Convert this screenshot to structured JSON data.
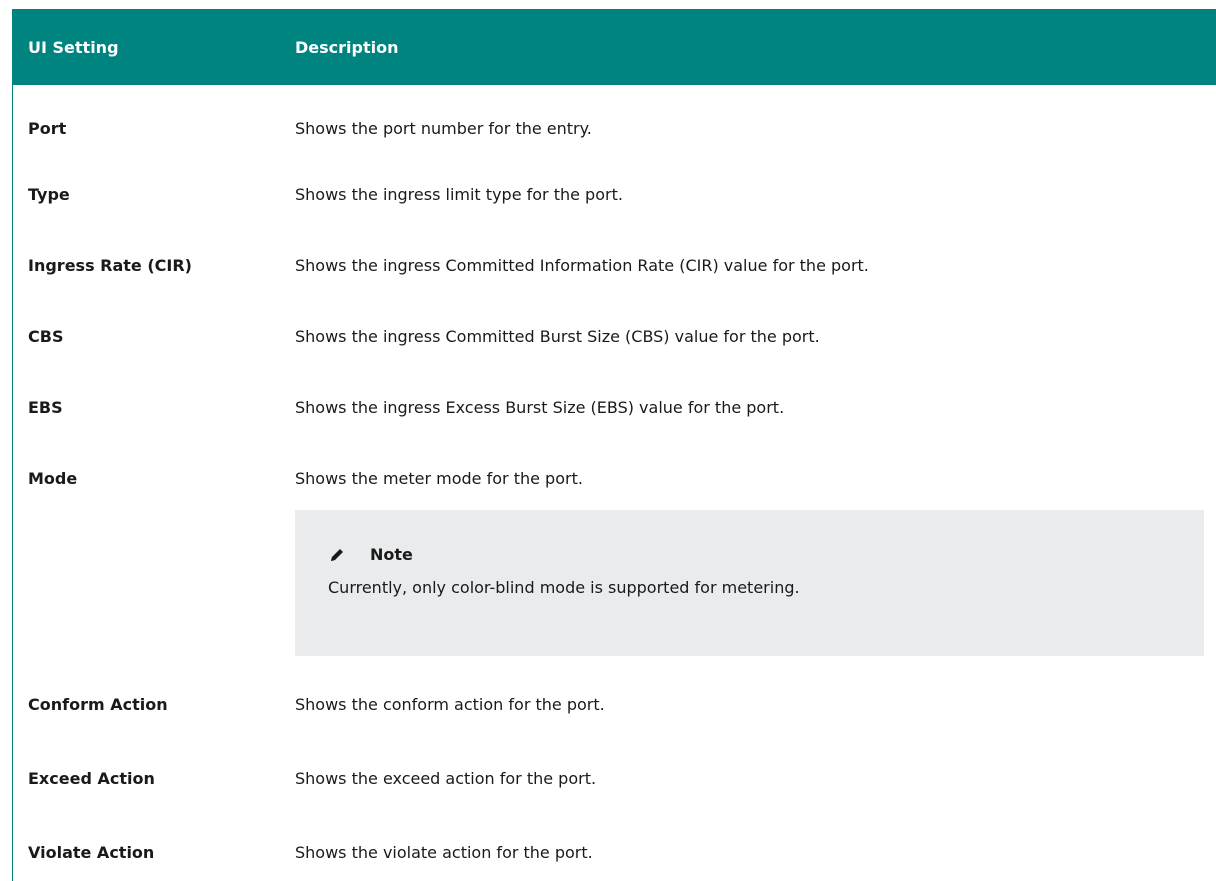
{
  "header": {
    "col_setting": "UI Setting",
    "col_description": "Description"
  },
  "rows": [
    {
      "setting": "Port",
      "description": "Shows the port number for the entry."
    },
    {
      "setting": "Type",
      "description": "Shows the ingress limit type for the port."
    },
    {
      "setting": "Ingress Rate (CIR)",
      "description": "Shows the ingress Committed Information Rate (CIR) value for the port."
    },
    {
      "setting": "CBS",
      "description": "Shows the ingress Committed Burst Size (CBS) value for the port."
    },
    {
      "setting": "EBS",
      "description": "Shows the ingress Excess Burst Size (EBS) value for the port."
    },
    {
      "setting": "Mode",
      "description": "Shows the meter mode for the port."
    },
    {
      "setting": "Conform Action",
      "description": "Shows the conform action for the port."
    },
    {
      "setting": "Exceed Action",
      "description": "Shows the exceed action for the port."
    },
    {
      "setting": "Violate Action",
      "description": "Shows the violate action for the port."
    }
  ],
  "note": {
    "icon": "pencil-icon",
    "title": "Note",
    "text": "Currently, only color-blind mode is supported for metering."
  },
  "colors": {
    "header_bg": "#00847f",
    "note_bg": "#e9ebec"
  }
}
